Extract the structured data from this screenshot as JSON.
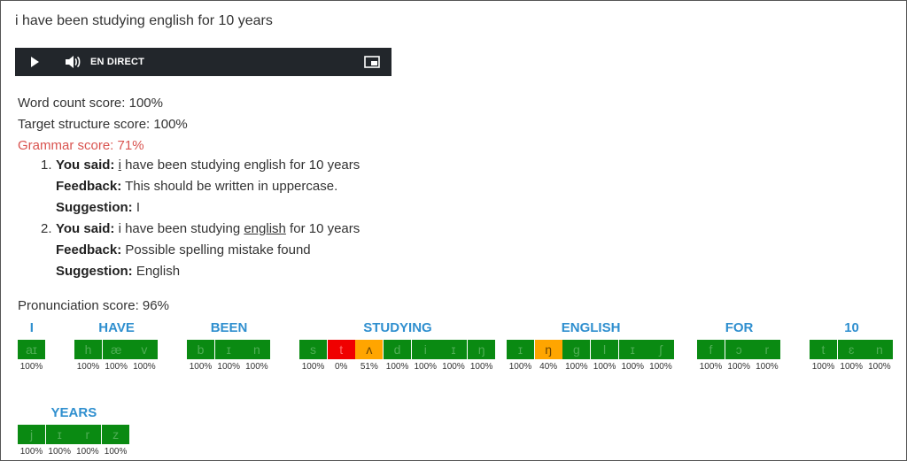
{
  "sentence": "i have been studying english for 10 years",
  "player": {
    "live_label": "EN DIRECT"
  },
  "scores": {
    "word_count": "Word count score: 100%",
    "target_structure": "Target structure score: 100%",
    "grammar": "Grammar score: 71%",
    "pronunciation": "Pronunciation score: 96%"
  },
  "colors": {
    "good": "#0a8a12",
    "warn": "#ffa500",
    "bad": "#f00000",
    "word_label": "#2f8fcf",
    "grammar": "#d9534f"
  },
  "feedback": [
    {
      "num": "1.",
      "you_said_label": "You said:",
      "said_pre": "",
      "said_err": "i",
      "said_post": " have been studying english for 10 years",
      "feedback_label": "Feedback:",
      "feedback": " This should be written in uppercase.",
      "suggestion_label": "Suggestion:",
      "suggestion": " I"
    },
    {
      "num": "2.",
      "you_said_label": "You said:",
      "said_pre": " i have been studying ",
      "said_err": "english",
      "said_post": " for 10 years",
      "feedback_label": "Feedback:",
      "feedback": " Possible spelling mistake found",
      "suggestion_label": "Suggestion:",
      "suggestion": " English"
    }
  ],
  "words": [
    {
      "label": "I",
      "phonemes": [
        {
          "p": "aɪ",
          "score": "100%",
          "level": "good"
        }
      ]
    },
    {
      "label": "HAVE",
      "phonemes": [
        {
          "p": "h",
          "score": "100%",
          "level": "good"
        },
        {
          "p": "æ",
          "score": "100%",
          "level": "good"
        },
        {
          "p": "v",
          "score": "100%",
          "level": "good"
        }
      ]
    },
    {
      "label": "BEEN",
      "phonemes": [
        {
          "p": "b",
          "score": "100%",
          "level": "good"
        },
        {
          "p": "ɪ",
          "score": "100%",
          "level": "good"
        },
        {
          "p": "n",
          "score": "100%",
          "level": "good"
        }
      ]
    },
    {
      "label": "STUDYING",
      "phonemes": [
        {
          "p": "s",
          "score": "100%",
          "level": "good"
        },
        {
          "p": "t",
          "score": "0%",
          "level": "bad"
        },
        {
          "p": "ʌ",
          "score": "51%",
          "level": "warn"
        },
        {
          "p": "d",
          "score": "100%",
          "level": "good"
        },
        {
          "p": "i",
          "score": "100%",
          "level": "good"
        },
        {
          "p": "ɪ",
          "score": "100%",
          "level": "good"
        },
        {
          "p": "ŋ",
          "score": "100%",
          "level": "good"
        }
      ]
    },
    {
      "label": "ENGLISH",
      "phonemes": [
        {
          "p": "ɪ",
          "score": "100%",
          "level": "good"
        },
        {
          "p": "ŋ",
          "score": "40%",
          "level": "warn"
        },
        {
          "p": "g",
          "score": "100%",
          "level": "good"
        },
        {
          "p": "l",
          "score": "100%",
          "level": "good"
        },
        {
          "p": "ɪ",
          "score": "100%",
          "level": "good"
        },
        {
          "p": "ʃ",
          "score": "100%",
          "level": "good"
        }
      ]
    },
    {
      "label": "FOR",
      "phonemes": [
        {
          "p": "f",
          "score": "100%",
          "level": "good"
        },
        {
          "p": "ɔ",
          "score": "100%",
          "level": "good"
        },
        {
          "p": "r",
          "score": "100%",
          "level": "good"
        }
      ]
    },
    {
      "label": "10",
      "phonemes": [
        {
          "p": "t",
          "score": "100%",
          "level": "good"
        },
        {
          "p": "ɛ",
          "score": "100%",
          "level": "good"
        },
        {
          "p": "n",
          "score": "100%",
          "level": "good"
        }
      ]
    },
    {
      "label": "YEARS",
      "phonemes": [
        {
          "p": "j",
          "score": "100%",
          "level": "good"
        },
        {
          "p": "ɪ",
          "score": "100%",
          "level": "good"
        },
        {
          "p": "r",
          "score": "100%",
          "level": "good"
        },
        {
          "p": "z",
          "score": "100%",
          "level": "good"
        }
      ]
    }
  ]
}
